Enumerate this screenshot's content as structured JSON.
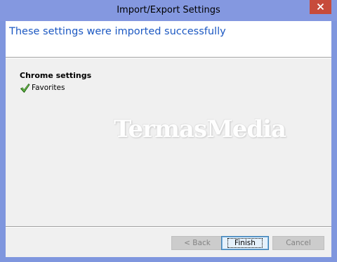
{
  "window": {
    "title": "Import/Export Settings"
  },
  "header": {
    "title": "These settings were imported successfully"
  },
  "results": {
    "section_title": "Chrome settings",
    "items": [
      {
        "label": "Favorites",
        "status_icon": "checkmark-icon"
      }
    ]
  },
  "watermark": {
    "text": "TermasMedia"
  },
  "buttons": {
    "back": {
      "label": "< Back",
      "enabled": false
    },
    "finish": {
      "label": "Finish",
      "enabled": true,
      "default": true
    },
    "cancel": {
      "label": "Cancel",
      "enabled": false
    }
  },
  "colors": {
    "window_frame": "#8498e0",
    "close_button": "#c74b3b",
    "header_title": "#1c58c2",
    "check_green": "#2e8b1f"
  }
}
